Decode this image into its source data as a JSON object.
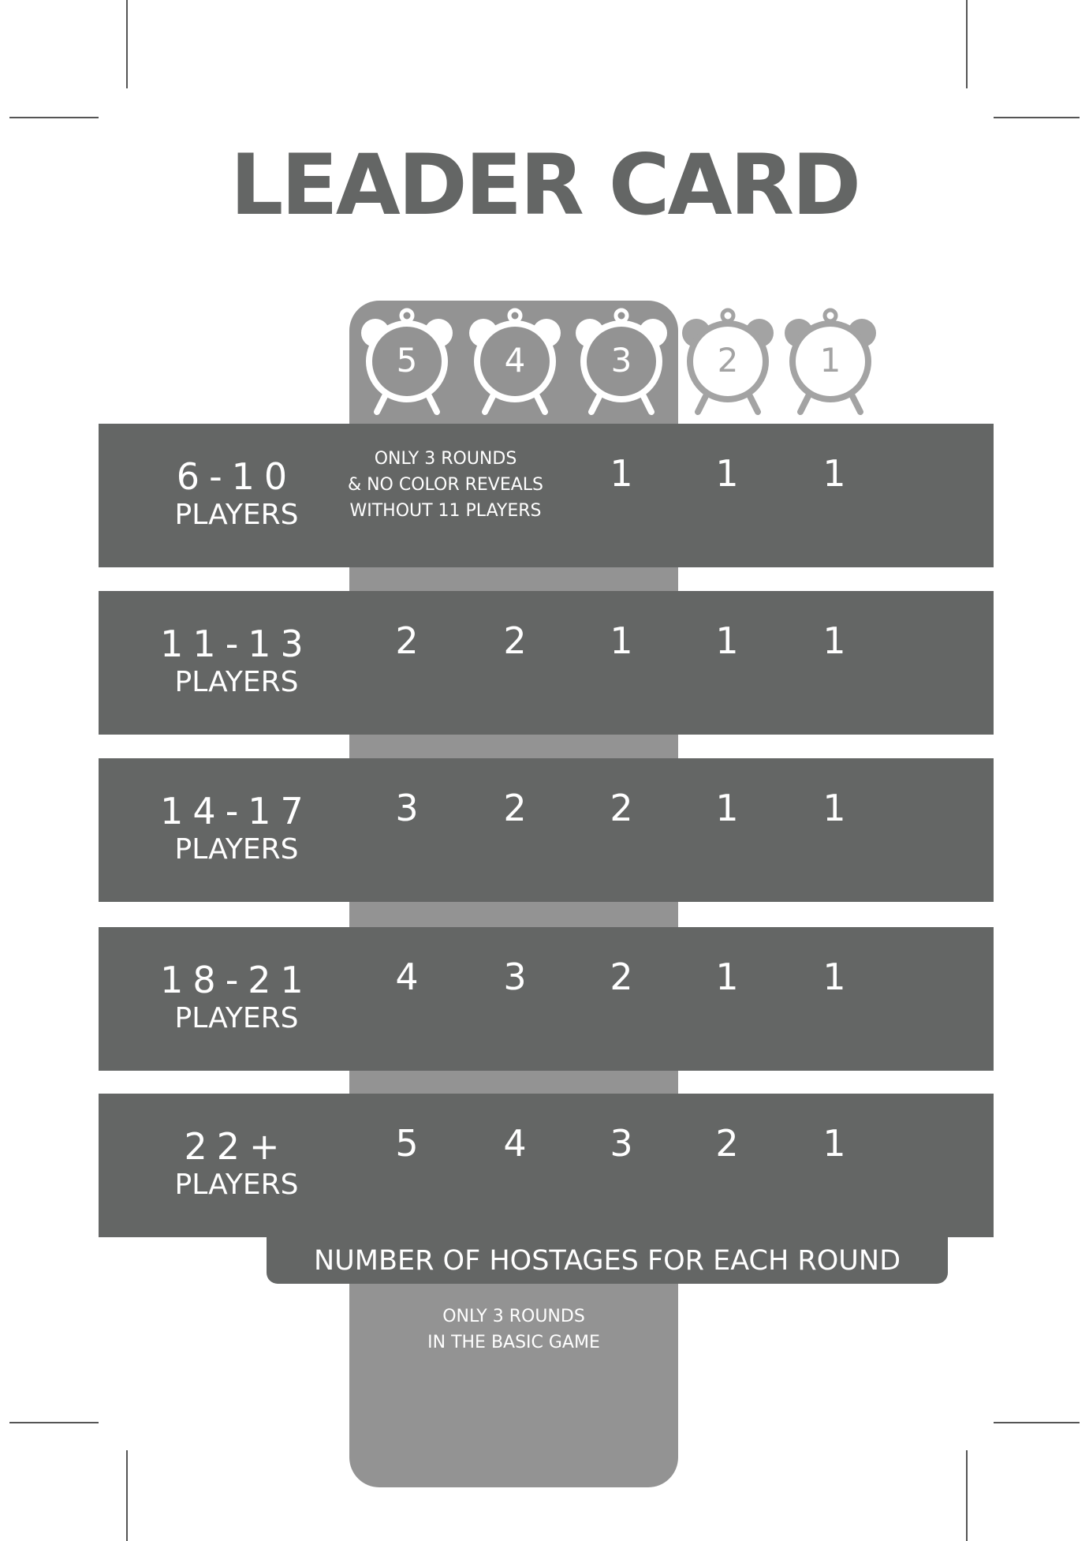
{
  "title": "LEADER CARD",
  "colors": {
    "row_dark": "#646665",
    "band_light": "#939393",
    "inactive_clock": "#a3a3a3",
    "text_light": "#ffffff"
  },
  "clocks": [
    {
      "label": "5",
      "icon": "alarm-clock-icon",
      "active": true
    },
    {
      "label": "4",
      "icon": "alarm-clock-icon",
      "active": true
    },
    {
      "label": "3",
      "icon": "alarm-clock-icon",
      "active": true
    },
    {
      "label": "2",
      "icon": "alarm-clock-icon",
      "active": false
    },
    {
      "label": "1",
      "icon": "alarm-clock-icon",
      "active": false
    }
  ],
  "rows": [
    {
      "range": "6-10",
      "players": "PLAYERS",
      "note": [
        "ONLY 3 ROUNDS",
        "& NO COLOR REVEALS",
        "WITHOUT 11 PLAYERS"
      ],
      "values": [
        "",
        "",
        "1",
        "1",
        "1"
      ]
    },
    {
      "range": "11-13",
      "players": "PLAYERS",
      "values": [
        "2",
        "2",
        "1",
        "1",
        "1"
      ]
    },
    {
      "range": "14-17",
      "players": "PLAYERS",
      "values": [
        "3",
        "2",
        "2",
        "1",
        "1"
      ]
    },
    {
      "range": "18-21",
      "players": "PLAYERS",
      "values": [
        "4",
        "3",
        "2",
        "1",
        "1"
      ]
    },
    {
      "range": "22+",
      "players": "PLAYERS",
      "values": [
        "5",
        "4",
        "3",
        "2",
        "1"
      ]
    }
  ],
  "footer_label": "NUMBER OF HOSTAGES FOR EACH ROUND",
  "basic_game_note": [
    "ONLY 3 ROUNDS",
    "IN THE BASIC GAME"
  ]
}
